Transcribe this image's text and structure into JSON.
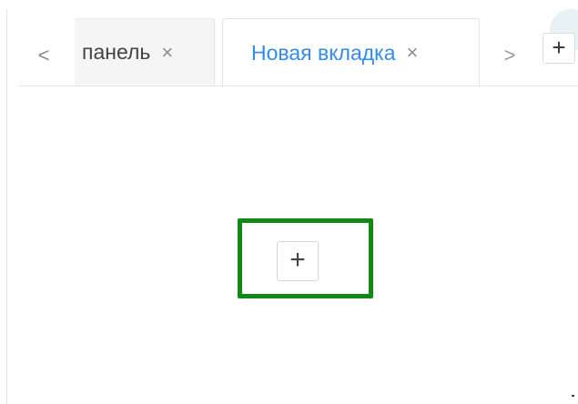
{
  "tabs": {
    "scroll_left_glyph": "<",
    "scroll_right_glyph": ">",
    "items": [
      {
        "label": "панель",
        "close_glyph": "×",
        "active": false
      },
      {
        "label": "Новая вкладка",
        "close_glyph": "×",
        "active": true
      }
    ],
    "add_tab_glyph": "+"
  },
  "content": {
    "add_button_glyph": "+"
  },
  "colors": {
    "active_tab_text": "#2f8cf0",
    "highlight_border": "#0e8a15",
    "inactive_tab_bg": "#f5f5f5"
  },
  "icons": {
    "scroll_left": "chevron-left-icon",
    "scroll_right": "chevron-right-icon",
    "close": "close-icon",
    "add": "plus-icon"
  }
}
